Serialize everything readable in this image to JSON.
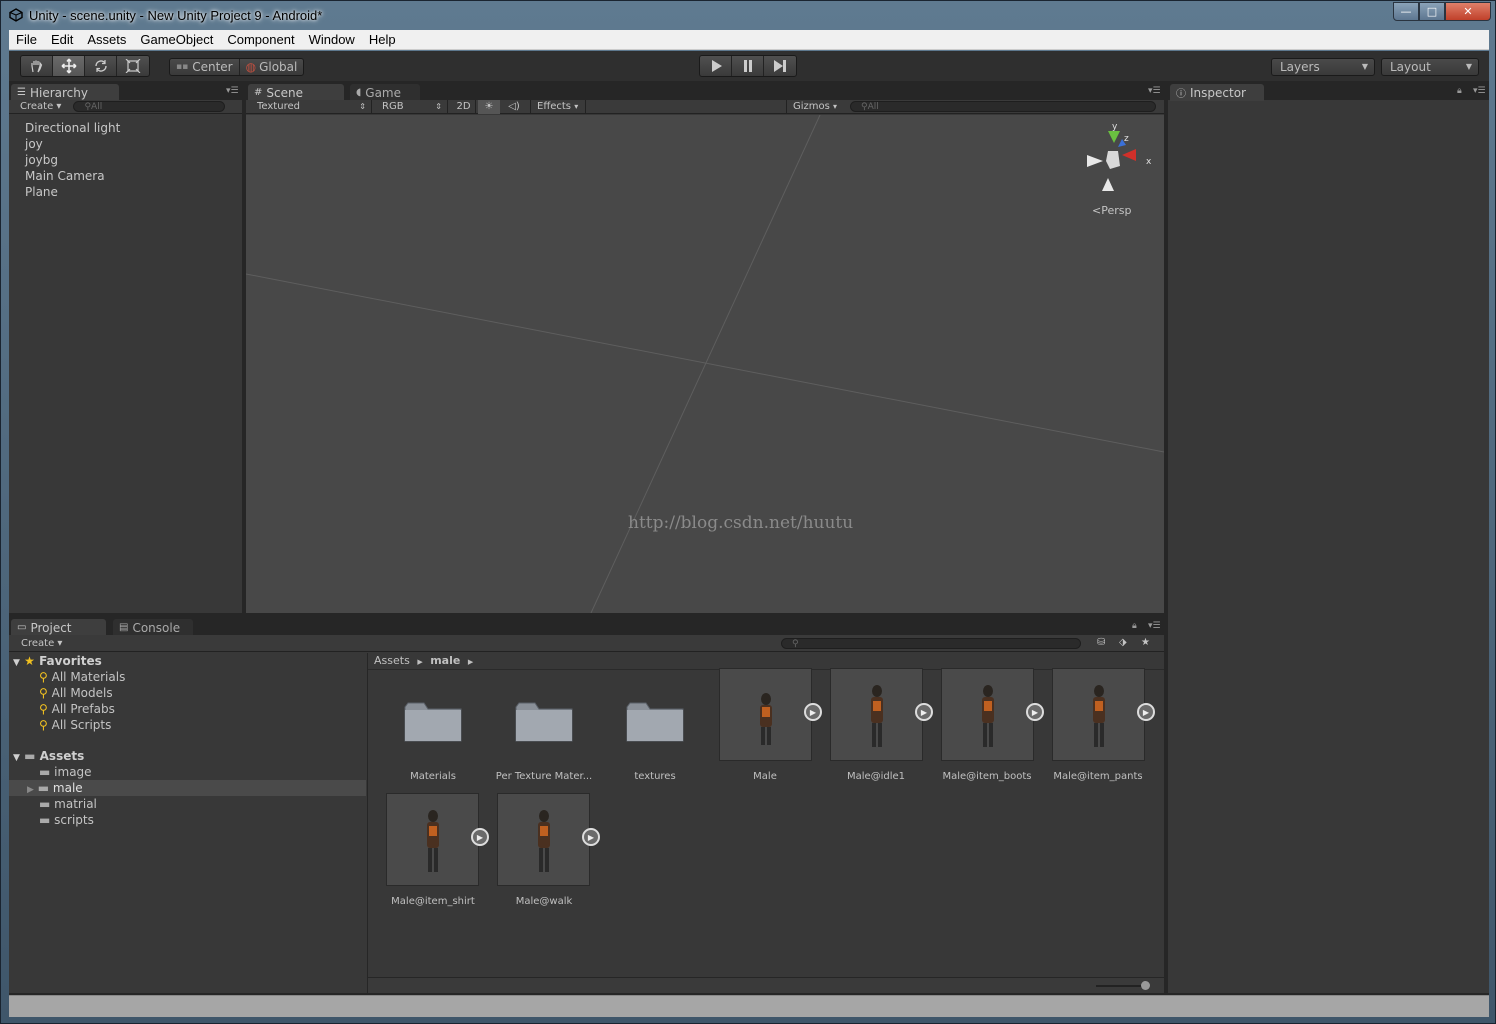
{
  "window": {
    "title": "Unity - scene.unity - New Unity Project 9 - Android*",
    "min_glyph": "—",
    "max_glyph": "□",
    "close_glyph": "✕"
  },
  "menubar": {
    "items": [
      "File",
      "Edit",
      "Assets",
      "GameObject",
      "Component",
      "Window",
      "Help"
    ]
  },
  "toolbar": {
    "pivot_center": "Center",
    "pivot_global": "Global",
    "layers": "Layers",
    "layout": "Layout"
  },
  "hierarchy": {
    "tab": "Hierarchy",
    "create": "Create",
    "search_placeholder": "All",
    "items": [
      "Directional light",
      "joy",
      "joybg",
      "Main Camera",
      "Plane"
    ]
  },
  "scene": {
    "tab_scene": "Scene",
    "tab_game": "Game",
    "render_mode": "Textured",
    "color_mode": "RGB",
    "mode_2d": "2D",
    "effects": "Effects",
    "gizmos": "Gizmos",
    "search_placeholder": "All",
    "persp": "Persp",
    "axis_x": "x",
    "axis_y": "y",
    "axis_z": "z",
    "watermark": "http://blog.csdn.net/huutu"
  },
  "inspector": {
    "tab": "Inspector"
  },
  "project": {
    "tab_project": "Project",
    "tab_console": "Console",
    "create": "Create",
    "favorites": {
      "label": "Favorites",
      "items": [
        "All Materials",
        "All Models",
        "All Prefabs",
        "All Scripts"
      ]
    },
    "assets": {
      "label": "Assets",
      "items": [
        "image",
        "male",
        "matrial",
        "scripts"
      ],
      "selected": "male"
    },
    "breadcrumb": [
      "Assets",
      "male"
    ],
    "folders": [
      "Materials",
      "Per Texture Mater...",
      "textures"
    ],
    "models": [
      "Male",
      "Male@idle1",
      "Male@item_boots",
      "Male@item_pants",
      "Male@item_shirt",
      "Male@walk"
    ]
  },
  "colors": {
    "panel_bg": "#383838",
    "scene_bg": "#484848",
    "selection": "#4a4a4a",
    "axis_x": "#d0302a",
    "axis_y": "#6ac040",
    "axis_z": "#3a70d8"
  }
}
